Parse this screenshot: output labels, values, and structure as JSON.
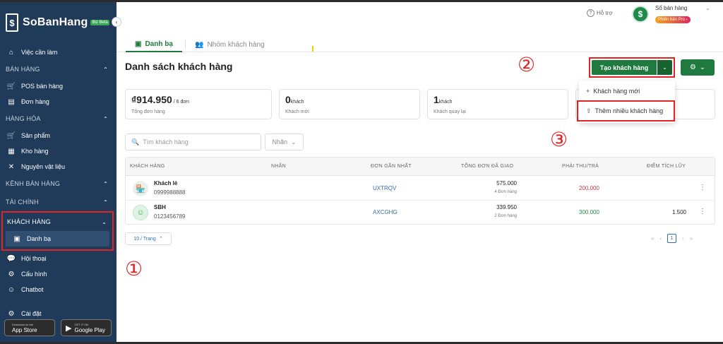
{
  "sidebar": {
    "brand": {
      "logo_glyph": "$",
      "name": "SoBanHang",
      "badge": "Biz Beta"
    },
    "nav_top": [
      {
        "icon": "home-icon",
        "label": "Việc cần làm"
      }
    ],
    "sections": [
      {
        "title": "BÁN HÀNG",
        "items": [
          {
            "icon": "cart-icon",
            "label": "POS bán hàng"
          },
          {
            "icon": "document-icon",
            "label": "Đơn hàng"
          }
        ]
      },
      {
        "title": "HÀNG HÓA",
        "items": [
          {
            "icon": "cart-icon",
            "label": "Sản phẩm"
          },
          {
            "icon": "warehouse-icon",
            "label": "Kho hàng"
          },
          {
            "icon": "utensils-icon",
            "label": "Nguyên vật liệu"
          }
        ]
      },
      {
        "title": "KÊNH BÁN HÀNG",
        "items": []
      },
      {
        "title": "TÀI CHÍNH",
        "items": []
      }
    ],
    "customer_group": {
      "title": "KHÁCH HÀNG",
      "active_item": {
        "icon": "contacts-icon",
        "label": "Danh bạ"
      }
    },
    "nav_bottom": [
      {
        "icon": "chat-icon",
        "label": "Hội thoại"
      },
      {
        "icon": "gear-icon",
        "label": "Cấu hình"
      },
      {
        "icon": "robot-icon",
        "label": "Chatbot"
      },
      {
        "icon": "gear-icon",
        "label": "Cài đặt"
      }
    ],
    "stores": {
      "appstore": {
        "small": "Download on the",
        "label": "App Store"
      },
      "googleplay": {
        "small": "GET IT ON",
        "label": "Google Play"
      }
    }
  },
  "topbar": {
    "help_label": "Hỗ trợ",
    "avatar_glyph": "$",
    "account_name": "Sổ bán hàng",
    "pro_badge": "Phiên bản Pro ›"
  },
  "tabs": [
    {
      "label": "Danh bạ",
      "active": true
    },
    {
      "label": "Nhóm khách hàng",
      "active": false
    }
  ],
  "page_title": "Danh sách khách hàng",
  "markers": {
    "one": "①",
    "two": "②",
    "three": "③"
  },
  "actions": {
    "create_label": "Tạo khách hàng",
    "dropdown": [
      {
        "icon": "plus-icon",
        "label": "Khách hàng mới"
      },
      {
        "icon": "upload-icon",
        "label": "Thêm nhiều khách hàng"
      }
    ]
  },
  "stats": [
    {
      "value": "₫914.950",
      "unit": " / 6 đơn",
      "label": "Tổng đơn hàng"
    },
    {
      "value": "0",
      "unit": "khách",
      "label": "Khách mới"
    },
    {
      "value": "1",
      "unit": "khách",
      "label": "Khách quay lại"
    }
  ],
  "filters": {
    "search_placeholder": "Tìm khách hàng",
    "label_filter": "Nhãn"
  },
  "table": {
    "headers": [
      "KHÁCH HÀNG",
      "NHÃN",
      "ĐƠN GẦN NHẤT",
      "TỔNG ĐƠN ĐÃ GIAO",
      "PHẢI THU/TRẢ",
      "ĐIỂM TÍCH LŨY"
    ],
    "rows": [
      {
        "name": "Khách lẻ",
        "phone": "0999988888",
        "label": "",
        "last_order": "UXTRQV",
        "total": "575.000",
        "order_count": "4 Đơn hàng",
        "receivable": "200.000",
        "receivable_color": "#d9363e",
        "points": ""
      },
      {
        "name": "SBH",
        "phone": "0123456789",
        "label": "",
        "last_order": "AXCGHG",
        "total": "339.950",
        "order_count": "2 Đơn hàng",
        "receivable": "300.000",
        "receivable_color": "#1e8a3f",
        "points": "1.500"
      }
    ]
  },
  "pagination": {
    "page_size": "10 / Trang",
    "current_page": "1"
  },
  "colors": {
    "sidebar_bg": "#1f3b59",
    "primary_green": "#1e7a3f",
    "highlight_red": "#e02424",
    "link_blue": "#2e6fb3"
  }
}
